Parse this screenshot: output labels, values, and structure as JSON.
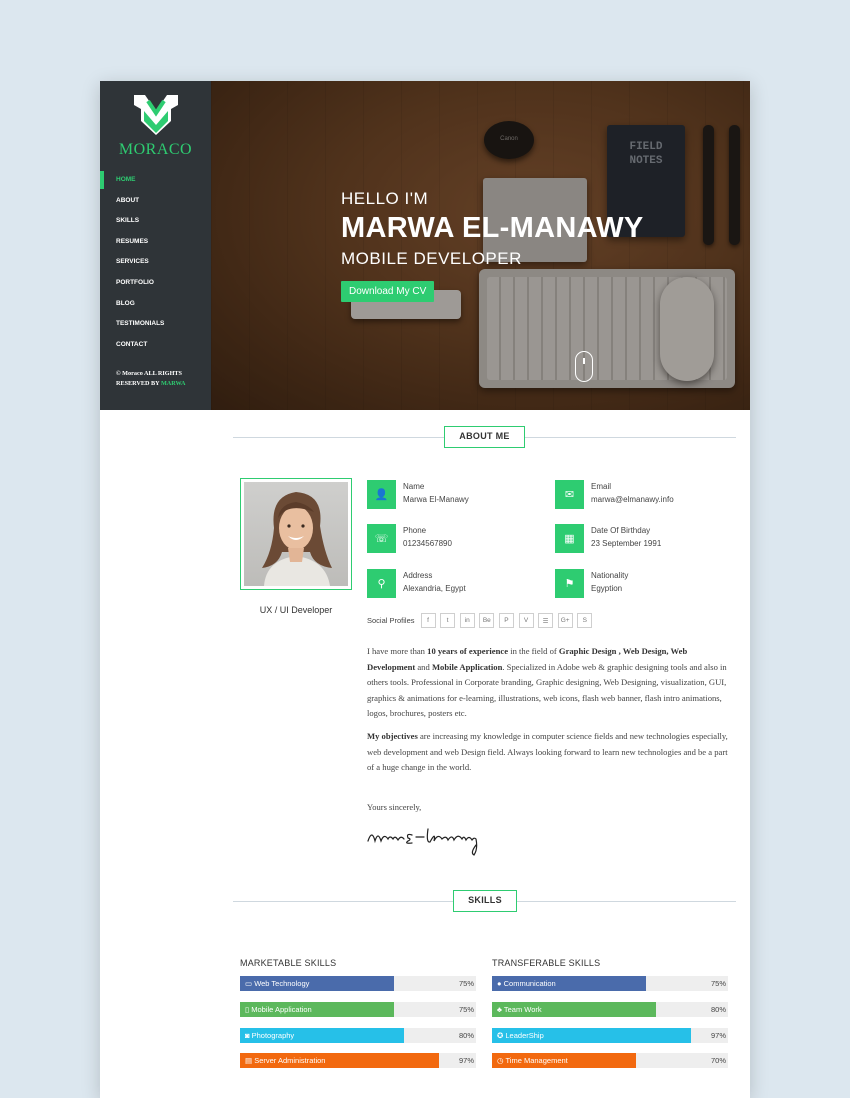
{
  "brand": {
    "name": "MORACO"
  },
  "nav": [
    {
      "label": "HOME",
      "active": true
    },
    {
      "label": "ABOUT"
    },
    {
      "label": "SKILLS"
    },
    {
      "label": "RESUMES"
    },
    {
      "label": "SERVICES"
    },
    {
      "label": "PORTFOLIO"
    },
    {
      "label": "BLOG"
    },
    {
      "label": "TESTIMONIALS"
    },
    {
      "label": "CONTACT"
    }
  ],
  "footer": {
    "line1": "© Moraco ALL RIGHTS",
    "line2_prefix": "RESERVED BY ",
    "line2_name": "MARWA"
  },
  "hero": {
    "hello": "HELLO I'M",
    "name": "MARWA EL-MANAWY",
    "role": "MOBILE  DEVELOPER",
    "cta": "Download My CV",
    "notebook_line1": "FIELD",
    "notebook_line2": "NOTES",
    "lenscap": "Canon"
  },
  "about": {
    "section_title": "ABOUT ME",
    "caption": "UX / UI Developer",
    "info": [
      {
        "icon": "user-icon",
        "glyph": "👤",
        "label": "Name",
        "value": "Marwa El-Manawy"
      },
      {
        "icon": "email-icon",
        "glyph": "✉",
        "label": "Email",
        "value": "marwa@elmanawy.info"
      },
      {
        "icon": "phone-icon",
        "glyph": "☏",
        "label": "Phone",
        "value": "01234567890"
      },
      {
        "icon": "calendar-icon",
        "glyph": "▦",
        "label": "Date Of Birthday",
        "value": "23 September 1991"
      },
      {
        "icon": "map-pin-icon",
        "glyph": "⚲",
        "label": "Address",
        "value": "Alexandria, Egypt"
      },
      {
        "icon": "flag-icon",
        "glyph": "⚑",
        "label": "Nationality",
        "value": "Egyption"
      }
    ],
    "social_label": "Social Profiles",
    "social": [
      {
        "icon": "facebook-icon",
        "glyph": "f"
      },
      {
        "icon": "twitter-icon",
        "glyph": "t"
      },
      {
        "icon": "linkedin-icon",
        "glyph": "in"
      },
      {
        "icon": "behance-icon",
        "glyph": "Be"
      },
      {
        "icon": "pinterest-icon",
        "glyph": "P"
      },
      {
        "icon": "vimeo-icon",
        "glyph": "V"
      },
      {
        "icon": "rss-icon",
        "glyph": "☰"
      },
      {
        "icon": "google-plus-icon",
        "glyph": "G+"
      },
      {
        "icon": "skype-icon",
        "glyph": "S"
      }
    ],
    "bio1": {
      "t1": "I have more than ",
      "b1": "10 years of experience",
      "t2": " in the field of ",
      "b2": "Graphic Design , Web Design, Web Development",
      "t3": " and ",
      "b3": "Mobile Application",
      "t4": ". Specialized in Adobe web & graphic designing tools and also in others tools. Professional in Corporate branding, Graphic designing, Web Designing, visualization, GUI, graphics & animations for e-learning, illustrations, web icons, flash web banner, flash intro animations, logos, brochures, posters etc."
    },
    "bio2": {
      "b1": "My objectives",
      "t1": " are increasing my knowledge in computer science fields and new technologies especially, web development and web Design field. Always looking forward to learn new technologies and be a part of a huge change in the world."
    },
    "sincerely": "Yours sincerely,",
    "signature": "Marwa El-Manawy"
  },
  "skills": {
    "section_title": "SKILLS",
    "marketable": {
      "title": "MARKETABLE SKILLS",
      "items": [
        {
          "name": "Web Technology",
          "icon": "monitor-icon",
          "glyph": "▭",
          "percent": 75,
          "label": "75%",
          "color": "#4a6bab"
        },
        {
          "name": "Mobile Application",
          "icon": "mobile-icon",
          "glyph": "▯",
          "percent": 75,
          "label": "75%",
          "color": "#5cb85c"
        },
        {
          "name": "Photography",
          "icon": "camera-icon",
          "glyph": "◙",
          "percent": 80,
          "label": "80%",
          "color": "#26c0e8"
        },
        {
          "name": "Server Administration",
          "icon": "server-icon",
          "glyph": "▤",
          "percent": 97,
          "label": "97%",
          "color": "#f2690f"
        }
      ]
    },
    "transferable": {
      "title": "TRANSFERABLE SKILLS",
      "items": [
        {
          "name": "Communication",
          "icon": "chat-icon",
          "glyph": "●",
          "percent": 75,
          "label": "75%",
          "color": "#4a6bab"
        },
        {
          "name": "Team Work",
          "icon": "team-icon",
          "glyph": "♣",
          "percent": 80,
          "label": "80%",
          "color": "#5cb85c"
        },
        {
          "name": "LeaderShip",
          "icon": "leadership-icon",
          "glyph": "✪",
          "percent": 97,
          "label": "97%",
          "color": "#26c0e8"
        },
        {
          "name": "Time Management",
          "icon": "clock-icon",
          "glyph": "◷",
          "percent": 70,
          "label": "70%",
          "color": "#f2690f"
        }
      ]
    }
  },
  "colors": {
    "accent": "#2ecc71",
    "sidebar": "#2f3438"
  }
}
